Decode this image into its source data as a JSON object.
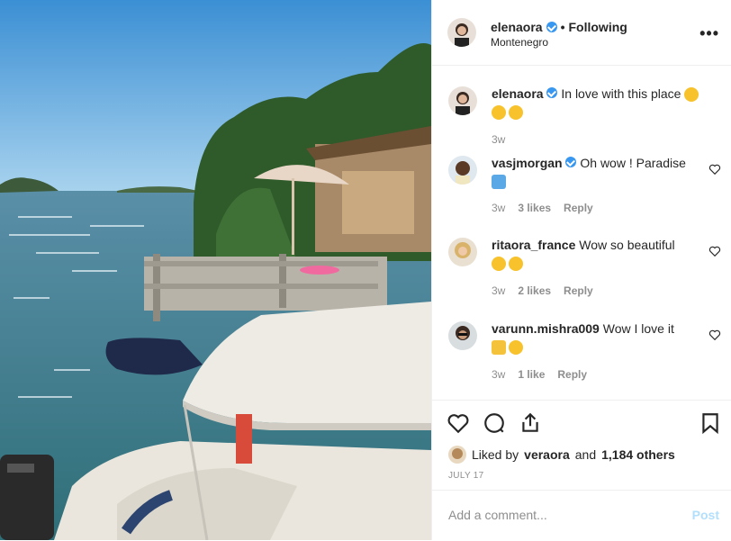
{
  "post": {
    "username": "elenaora",
    "follow_status": "Following",
    "location": "Montenegro",
    "separator": "•",
    "more_icon": "more-options-icon"
  },
  "caption": {
    "username": "elenaora",
    "text": "In love with this place",
    "time": "3w"
  },
  "comments": [
    {
      "username": "vasjmorgan",
      "verified": true,
      "text": "Oh wow ! Paradise",
      "time": "3w",
      "likes": "3 likes",
      "reply": "Reply"
    },
    {
      "username": "ritaora_france",
      "verified": false,
      "text": "Wow so beautiful",
      "time": "3w",
      "likes": "2 likes",
      "reply": "Reply"
    },
    {
      "username": "varunn.mishra009",
      "verified": false,
      "text": "Wow I love it",
      "time": "3w",
      "likes": "1 like",
      "reply": "Reply"
    }
  ],
  "likes": {
    "prefix": "Liked by",
    "user": "veraora",
    "and": "and",
    "others": "1,184 others"
  },
  "date": "JULY 17",
  "add_comment": {
    "placeholder": "Add a comment...",
    "post_label": "Post"
  },
  "colors": {
    "verified": "#3897f0",
    "post_disabled": "#b2dffc",
    "muted": "#8e8e8e"
  }
}
